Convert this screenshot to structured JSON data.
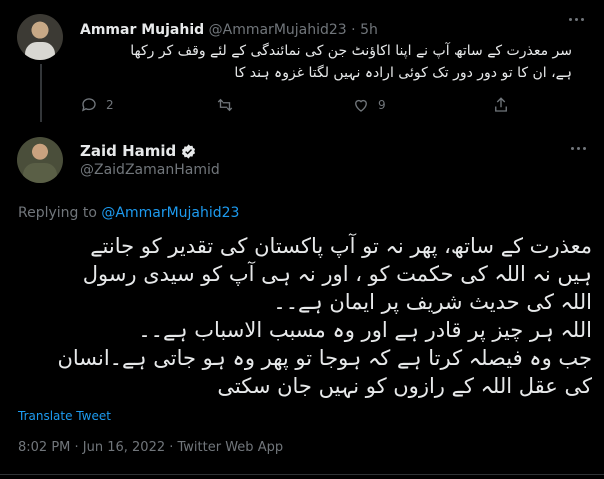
{
  "reply": {
    "author_name": "Ammar Mujahid",
    "author_handle": "@AmmarMujahid23",
    "separator": " · ",
    "time": "5h",
    "text_line1": "سر معذرت کے ساتھ آپ نے اپنا اکاؤنٹ جن کی نمائندگی کے لئے وقف کر رکھا",
    "text_line2": "ہے، ان کا تو دور دور تک کوئی ارادہ نہیں لگتا غزوہ ہند کا",
    "reply_count": "2",
    "like_count": "9"
  },
  "main": {
    "author_name": "Zaid Hamid",
    "author_handle": "@ZaidZamanHamid",
    "replying_prefix": "Replying to ",
    "replying_handle": "@AmmarMujahid23",
    "text_lines": [
      "معذرت کے ساتھ، پھر نہ تو آپ پاکستان کی تقدیر کو جانتے",
      "ہیں نہ اللہ کی حکمت کو ، اور نہ ہی آپ کو سیدی رسول",
      "اللہ کی حدیث شریف پر ایمان ہے۔۔",
      "اللہ ہر چیز پر قادر ہے اور وہ مسبب الاسباب ہے۔۔",
      "جب وہ فیصلہ کرتا ہے کہ ہوجا تو پھر وہ ہو جاتی ہے۔انسان",
      "کی عقل اللہ کے رازوں کو نہیں جان سکتی"
    ],
    "translate_label": "Translate Tweet",
    "timestamp": "8:02 PM · Jun 16, 2022 · Twitter Web App"
  },
  "icons": {
    "reply": "speech-bubble-icon",
    "retweet": "retweet-icon",
    "like": "heart-icon",
    "share": "share-icon",
    "verified": "verified-badge-icon",
    "more": "more-dots-icon"
  },
  "colors": {
    "accent": "#1d9bf0",
    "background": "#000000",
    "text": "#e7e9ea",
    "muted": "#71767b"
  }
}
